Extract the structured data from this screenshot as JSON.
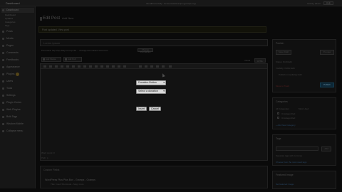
{
  "adminbar": {
    "site": "Dashboard",
    "center_text": "WordPress Daily - Screencast/Gramps (gramps.org)",
    "howdy": "Howdy, admin",
    "help": "Help"
  },
  "sidebar": {
    "items": [
      {
        "label": "Dashboard",
        "top": 0
      },
      {
        "label": "Dashboard",
        "sub": true
      },
      {
        "label": "Updates",
        "sub": true
      },
      {
        "label": "Categories",
        "sub": true
      },
      {
        "label": "Tags",
        "sub": true
      },
      {
        "label": "Posts"
      },
      {
        "label": "Media"
      },
      {
        "label": "Pages"
      },
      {
        "label": "Comments"
      },
      {
        "label": "Feedbacks"
      },
      {
        "label": "Appearance"
      },
      {
        "label": "Plugins"
      },
      {
        "label": "Users"
      },
      {
        "label": "Tools"
      },
      {
        "label": "Settings"
      },
      {
        "label": "Plugin Center"
      },
      {
        "label": "Web Plugins"
      },
      {
        "label": "Bulk Tags"
      },
      {
        "label": "Wisdom Mobile"
      },
      {
        "label": "Collapse menu"
      }
    ]
  },
  "header": {
    "title": "Edit Post",
    "sub": "Add New"
  },
  "notice": {
    "text": "Post updated. View post"
  },
  "editor": {
    "title_value": "Lorem ipsum",
    "permalink": "Permalink: http://wp-daily.com/?p=40 ... Change Permalinks   View Post",
    "permalink_btn": "Change Permalinks",
    "upload_label": "Add Media",
    "insert_label": "Add Poll",
    "tab_visual": "Visual",
    "tab_html": "HTML",
    "word_count": "Word count: 0",
    "path": "Path: p"
  },
  "dialog": {
    "select1": "Donation Button",
    "select2": "Select a donation",
    "insert_button": "Insert",
    "cancel_button": "Cancel"
  },
  "meta": {
    "heading": "Custom Fields",
    "line1": "WordPress Plus Plus Box - Gramps - Gramps",
    "line2": "Title: Insert Shortcode  -  Slug: more"
  },
  "publish": {
    "heading": "Publish",
    "save_draft": "Save Draft",
    "preview": "Preview",
    "status": "Status: Draft  Edit",
    "visibility": "Visibility: Public  Edit",
    "immediately": "Publish immediately  Edit",
    "trash": "Move to Trash",
    "publish_btn": "Publish"
  },
  "categories": {
    "heading": "Categories",
    "tab_all": "All Categories",
    "tab_used": "Most Used",
    "cat1": "Uncategorized",
    "cat2": "Uncategorized",
    "add_new": "+ Add New Category"
  },
  "tags": {
    "heading": "Tags",
    "add_btn": "Add",
    "hint": "Separate tags with commas",
    "choose": "Choose from the most used tags"
  },
  "featured": {
    "heading": "Featured Image",
    "set": "Set featured image"
  }
}
